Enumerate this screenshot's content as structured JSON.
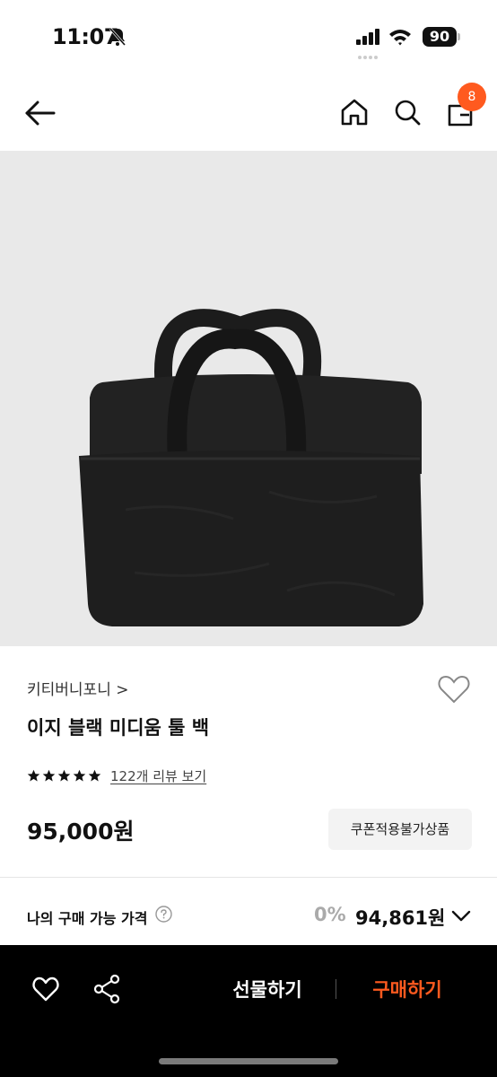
{
  "status_bar": {
    "time": "11:07",
    "battery": "90",
    "icons": [
      "bell-slash-icon",
      "signal-icon",
      "wifi-icon",
      "battery-icon"
    ]
  },
  "nav": {
    "icons": [
      "back-arrow-icon",
      "home-icon",
      "search-icon",
      "cart-icon"
    ],
    "cart_count": "8",
    "accent_color": "#ff5a1f"
  },
  "product": {
    "brand": "키티버니포니 >",
    "title": "이지 블랙 미디움 툴 백",
    "rating": 5,
    "rating_max": 5,
    "review_link": "122개 리뷰 보기",
    "price": "95,000원",
    "coupon_badge": "쿠폰적용불가상품"
  },
  "my_price": {
    "label": "나의 구매 가능 가격",
    "discount": "0%",
    "value": "94,861원"
  },
  "bottom_bar": {
    "gift_label": "선물하기",
    "buy_label": "구매하기",
    "buy_color": "#ff5a1f"
  }
}
